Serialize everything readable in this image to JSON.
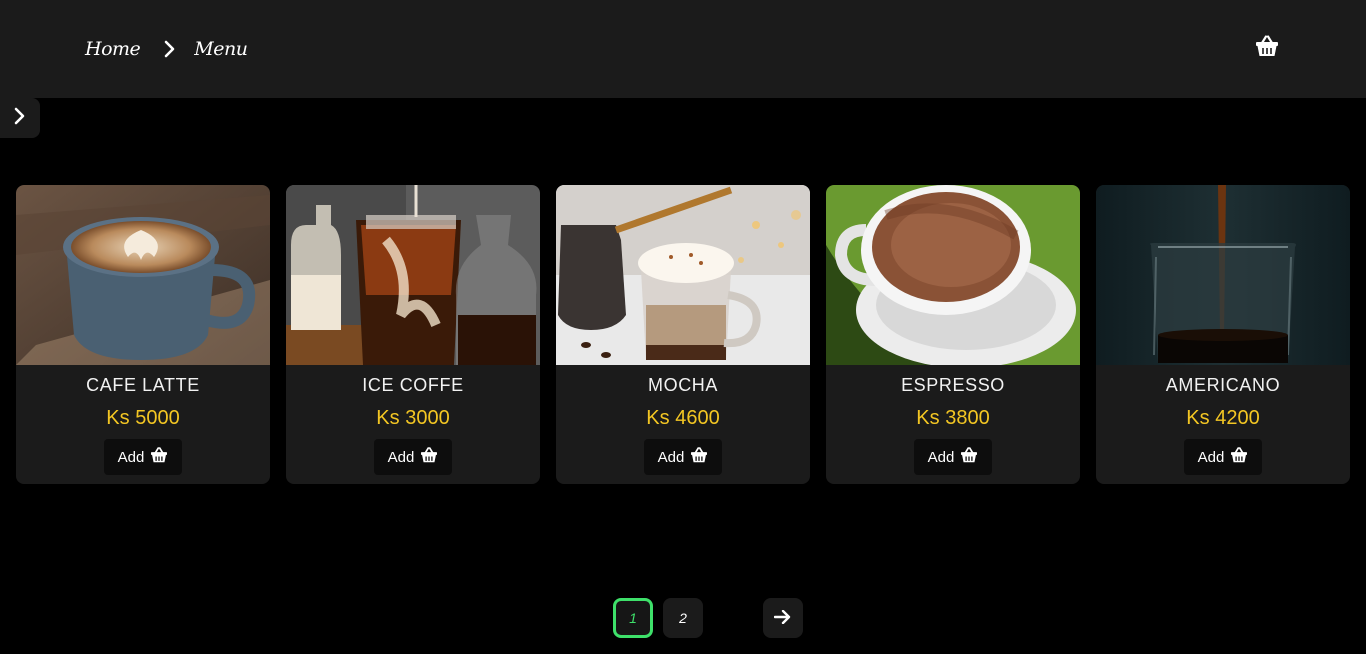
{
  "header": {
    "breadcrumb": [
      "Home",
      "Menu"
    ],
    "cart_icon": "basket-icon"
  },
  "sidebar_toggle": {
    "icon": "chevron-right-icon"
  },
  "products": [
    {
      "name": "CAFE LATTE",
      "price": "Ks 5000",
      "add_label": "Add"
    },
    {
      "name": "ICE COFFE",
      "price": "Ks 3000",
      "add_label": "Add"
    },
    {
      "name": "MOCHA",
      "price": "Ks 4600",
      "add_label": "Add"
    },
    {
      "name": "ESPRESSO",
      "price": "Ks 3800",
      "add_label": "Add"
    },
    {
      "name": "AMERICANO",
      "price": "Ks 4200",
      "add_label": "Add"
    }
  ],
  "pagination": {
    "pages": [
      "1",
      "2"
    ],
    "active_page": "1",
    "next_icon": "arrow-right-icon"
  },
  "colors": {
    "header_bg": "#1b1b1b",
    "card_bg": "#1b1b1b",
    "price": "#f3c623",
    "active_page": "#3ee06a"
  }
}
